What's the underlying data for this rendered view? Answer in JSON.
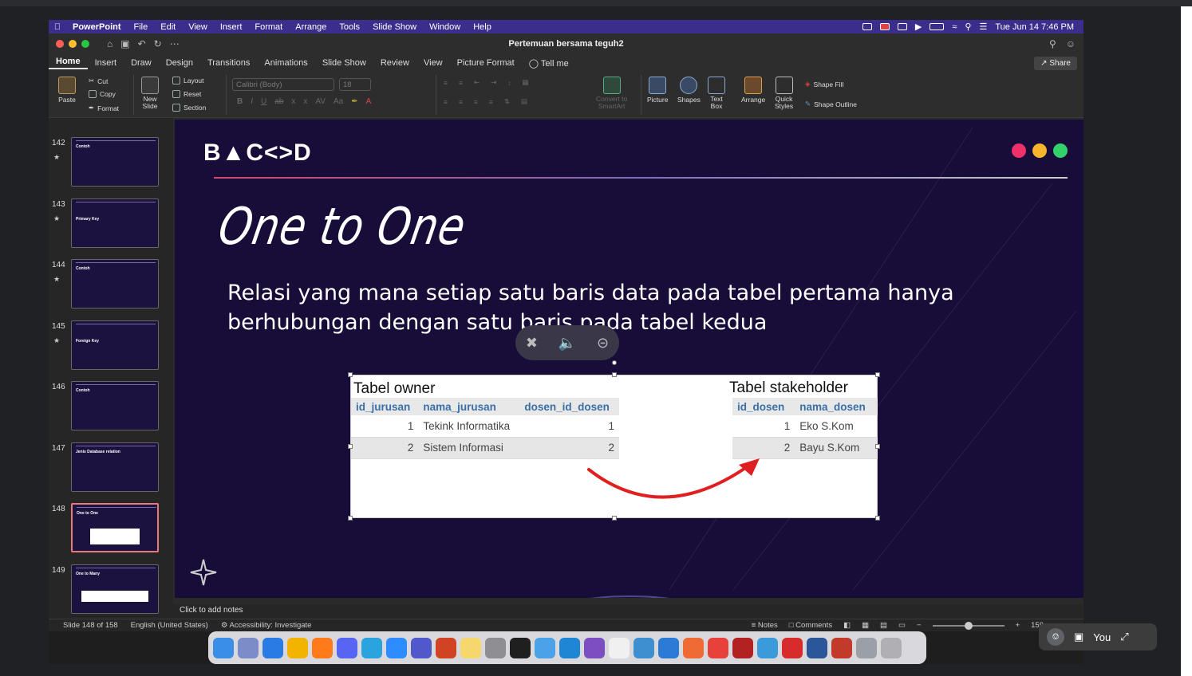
{
  "menubar": {
    "app": "PowerPoint",
    "items": [
      "File",
      "Edit",
      "View",
      "Insert",
      "Format",
      "Arrange",
      "Tools",
      "Slide Show",
      "Window",
      "Help"
    ],
    "clock": "Tue Jun 14  7:46 PM"
  },
  "window": {
    "title": "Pertemuan bersama teguh2"
  },
  "ribbon": {
    "tabs": [
      "Home",
      "Insert",
      "Draw",
      "Design",
      "Transitions",
      "Animations",
      "Slide Show",
      "Review",
      "View",
      "Picture Format"
    ],
    "tell_me": "Tell me",
    "share": "Share",
    "paste": "Paste",
    "cut": "Cut",
    "copy": "Copy",
    "format": "Format",
    "new_slide_1": "New",
    "new_slide_2": "Slide",
    "layout": "Layout",
    "reset": "Reset",
    "section": "Section",
    "font": "Calibri (Body)",
    "size": "18",
    "convert_1": "Convert to",
    "convert_2": "SmartArt",
    "picture": "Picture",
    "shapes": "Shapes",
    "textbox_1": "Text",
    "textbox_2": "Box",
    "arrange": "Arrange",
    "quick_1": "Quick",
    "quick_2": "Styles",
    "shape_fill": "Shape Fill",
    "shape_outline": "Shape Outline"
  },
  "thumbnails": [
    {
      "num": "142",
      "star": "★",
      "title": "Contoh"
    },
    {
      "num": "143",
      "star": "★",
      "title": "Primary Key"
    },
    {
      "num": "144",
      "star": "★",
      "title": "Contoh"
    },
    {
      "num": "145",
      "star": "★",
      "title": "Foreign Key"
    },
    {
      "num": "146",
      "star": "",
      "title": "Contoh"
    },
    {
      "num": "147",
      "star": "",
      "title": "Jenis Database relation"
    },
    {
      "num": "148",
      "star": "",
      "title": "One to One"
    },
    {
      "num": "149",
      "star": "",
      "title": "One to Many"
    }
  ],
  "slide": {
    "logo": "B▲C<>D",
    "title": "One to One",
    "body": "Relasi yang mana setiap satu baris data pada tabel pertama hanya berhubungan dengan satu baris pada tabel kedua",
    "owner_label": "Tabel owner",
    "owner_headers": [
      "id_jurusan",
      "nama_jurusan",
      "dosen_id_dosen"
    ],
    "owner_rows": [
      [
        "1",
        "Tekink Informatika",
        "1"
      ],
      [
        "2",
        "Sistem Informasi",
        "2"
      ]
    ],
    "stake_label": "Tabel stakeholder",
    "stake_headers": [
      "id_dosen",
      "nama_dosen"
    ],
    "stake_rows": [
      [
        "1",
        "Eko S.Kom"
      ],
      [
        "2",
        "Bayu S.Kom"
      ]
    ]
  },
  "notes": "Click to add notes",
  "status": {
    "slide": "Slide 148 of 158",
    "language": "English (United States)",
    "accessibility": "Accessibility: Investigate",
    "notes": "Notes",
    "comments": "Comments",
    "zoom": "159"
  },
  "meet": {
    "you": "You"
  }
}
